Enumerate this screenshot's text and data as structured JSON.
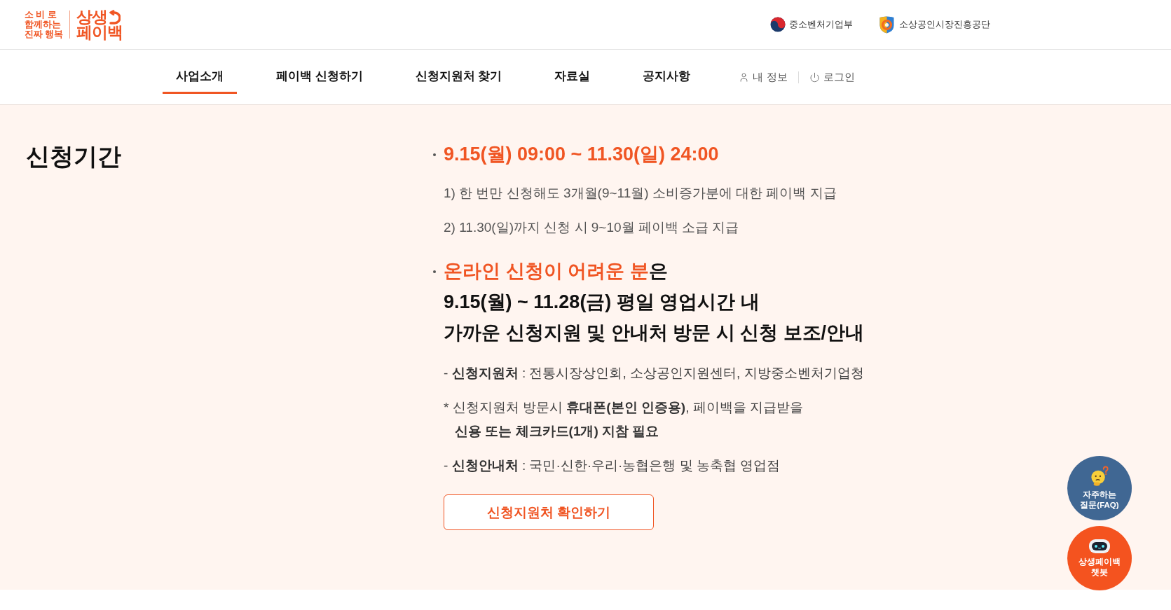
{
  "header": {
    "logo": {
      "slogan_lines": [
        "소 비 로",
        "함께하는",
        "진짜 행복"
      ],
      "wordmark_lines": [
        "상생",
        "페이백"
      ]
    },
    "partners": [
      {
        "kind": "ministry",
        "name": "중소벤처기업부"
      },
      {
        "kind": "agency",
        "name": "소상공인시장진흥공단"
      }
    ]
  },
  "nav": {
    "items": [
      {
        "label": "사업소개",
        "selected": true
      },
      {
        "label": "페이백 신청하기",
        "selected": false
      },
      {
        "label": "신청지원처 찾기",
        "selected": false
      },
      {
        "label": "자료실",
        "selected": false
      },
      {
        "label": "공지사항",
        "selected": false
      }
    ],
    "utility": [
      {
        "kind": "account",
        "label": "내 정보"
      },
      {
        "kind": "login",
        "label": "로그인"
      }
    ]
  },
  "section": {
    "title": "신청기간",
    "blocks": [
      {
        "heading": {
          "highlight": "9.15(월) 09:00 ~ 11.30(일) 24:00"
        },
        "notes": [
          "1) 한 번만 신청해도 3개월(9~11월) 소비증가분에 대한 페이백 지급",
          "2) 11.30(일)까지 신청 시 9~10월 페이백 소급 지급"
        ]
      },
      {
        "heading": {
          "highlight": "온라인 신청이 어려운 분",
          "rest": "은",
          "lines": [
            "9.15(월) ~ 11.28(금) 평일 영업시간 내",
            "가까운 신청지원 및 안내처 방문 시 신청 보조/안내"
          ]
        },
        "details": [
          {
            "lines": [
              "- **신청지원처** : 전통시장상인회, 소상공인지원센터, 지방중소벤처기업청"
            ]
          },
          {
            "lines": [
              "* 신청지원처 방문시 **휴대폰(본인 인증용)**, 페이백을 지급받을",
              "**신용 또는 체크카드(1개) 지참 필요**"
            ]
          },
          {
            "lines": [
              "- **신청안내처** : 국민·신한·우리·농협은행 및 농축협 영업점"
            ]
          }
        ]
      }
    ],
    "button_label": "신청지원처 확인하기"
  },
  "floating_buttons": [
    {
      "kind": "faq",
      "lines": [
        "자주하는",
        "질문(FAQ)"
      ]
    },
    {
      "kind": "chatbot",
      "lines": [
        "상생페이백",
        "챗봇"
      ]
    }
  ]
}
